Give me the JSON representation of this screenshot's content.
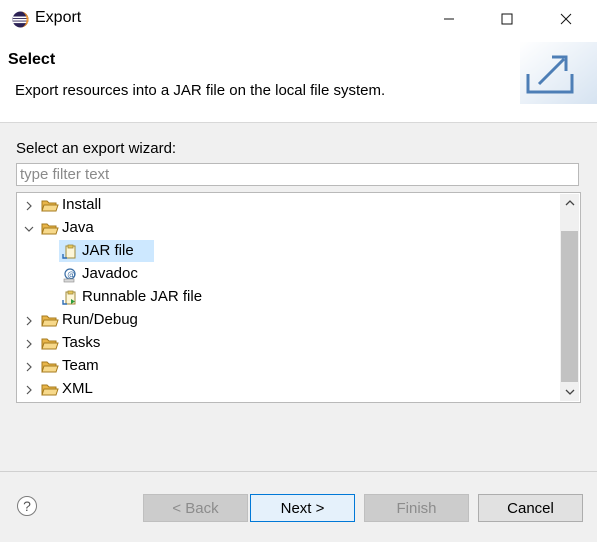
{
  "window": {
    "title": "Export",
    "icon": "eclipse-icon",
    "controls": {
      "minimize": "─",
      "maximize": "☐",
      "close": "✕"
    }
  },
  "header": {
    "title": "Select",
    "description": "Export resources into a JAR file on the local file system.",
    "graphic": "export-wizard-banner-icon"
  },
  "wizard": {
    "label": "Select an export wizard:",
    "filter_placeholder": "type filter text",
    "filter_value": ""
  },
  "tree": {
    "items": [
      {
        "label": "Install",
        "icon": "folder-icon",
        "expanded": false,
        "level": 0
      },
      {
        "label": "Java",
        "icon": "folder-icon",
        "expanded": true,
        "level": 0
      },
      {
        "label": "JAR file",
        "icon": "jar-file-icon",
        "level": 1,
        "selected": true
      },
      {
        "label": "Javadoc",
        "icon": "javadoc-icon",
        "level": 1
      },
      {
        "label": "Runnable JAR file",
        "icon": "runnable-jar-icon",
        "level": 1
      },
      {
        "label": "Run/Debug",
        "icon": "folder-icon",
        "expanded": false,
        "level": 0
      },
      {
        "label": "Tasks",
        "icon": "folder-icon",
        "expanded": false,
        "level": 0
      },
      {
        "label": "Team",
        "icon": "folder-icon",
        "expanded": false,
        "level": 0
      },
      {
        "label": "XML",
        "icon": "folder-icon",
        "expanded": false,
        "level": 0
      }
    ]
  },
  "buttons": {
    "help": "?",
    "back": "< Back",
    "next": "Next >",
    "finish": "Finish",
    "cancel": "Cancel"
  },
  "colors": {
    "selection": "#cde8ff",
    "default_button_border": "#0078d7",
    "folder": "#e8b54a"
  }
}
